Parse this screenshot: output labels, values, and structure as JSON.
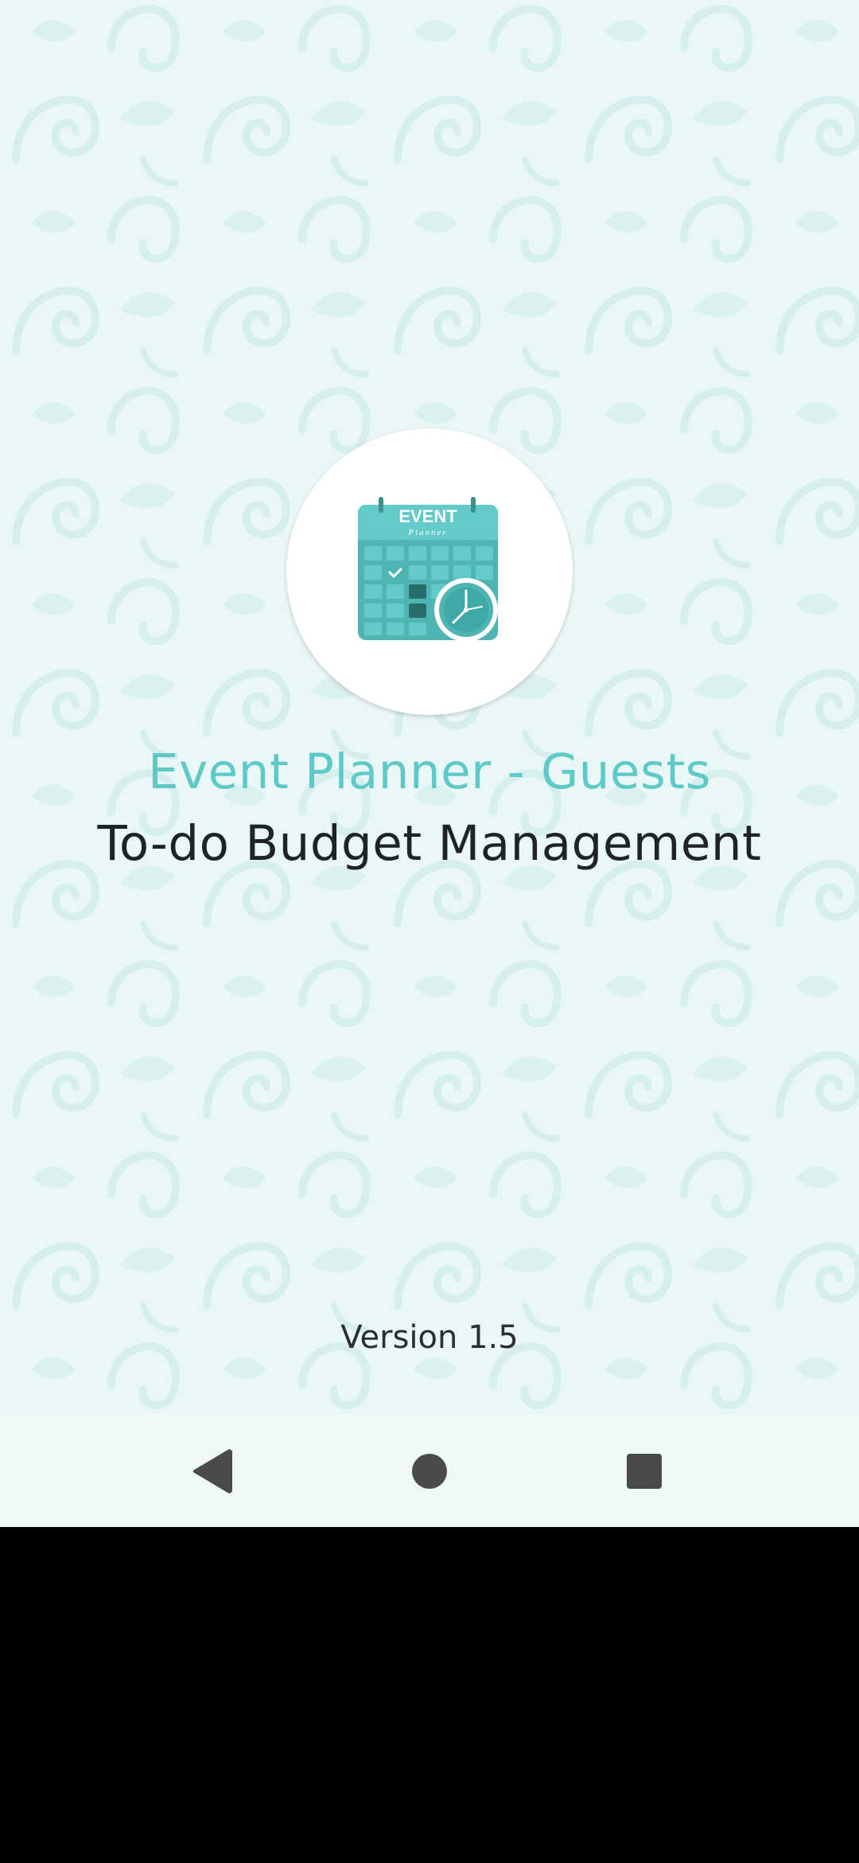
{
  "app": {
    "title_line1": "Event Planner - Guests",
    "title_line2": "To-do Budget Management",
    "version": "Version 1.5",
    "logo": {
      "icon": "event-planner-calendar-icon",
      "text_main": "EVENT",
      "text_sub": "Planner"
    }
  },
  "colors": {
    "accent": "#5ecac8",
    "background": "#e9f7f6",
    "title_dark": "#1f2226",
    "logo_teal": "#4fb5b2",
    "logo_dark": "#2a6e6c"
  },
  "navbar": {
    "back_icon": "back-triangle-icon",
    "home_icon": "home-circle-icon",
    "recent_icon": "recents-square-icon"
  }
}
